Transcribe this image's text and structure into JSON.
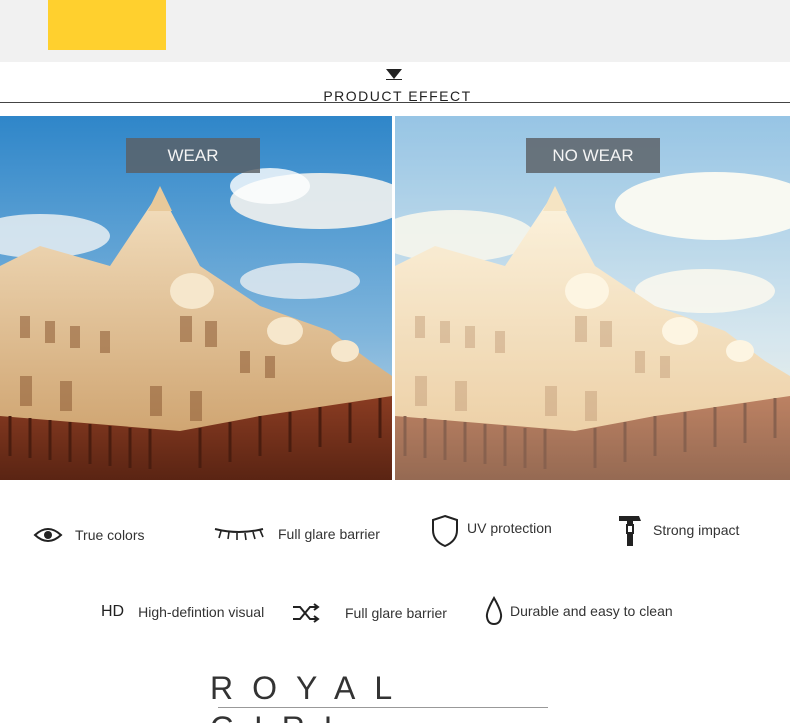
{
  "header": {
    "title": "PRODUCT EFFECT",
    "arrow_icon": "down-triangle-icon"
  },
  "comparison": {
    "left_tag": "WEAR",
    "right_tag": "NO WEAR"
  },
  "features_row1": [
    {
      "label": "True colors",
      "icon": "eye-icon"
    },
    {
      "label": "Full glare barrier",
      "icon": "eyelash-icon"
    },
    {
      "label": "UV protection",
      "icon": "shield-icon"
    },
    {
      "label": "Strong impact",
      "icon": "hammer-icon"
    }
  ],
  "features_row2": [
    {
      "label": "High-defintion visual",
      "badge": "HD"
    },
    {
      "label": "Full glare barrier",
      "icon": "shuffle-icon"
    },
    {
      "label": "Durable and easy to clean",
      "icon": "drop-icon"
    }
  ],
  "brand": {
    "logo_text": "ROYAL GIRL",
    "accent_color": "#ffd02e"
  }
}
